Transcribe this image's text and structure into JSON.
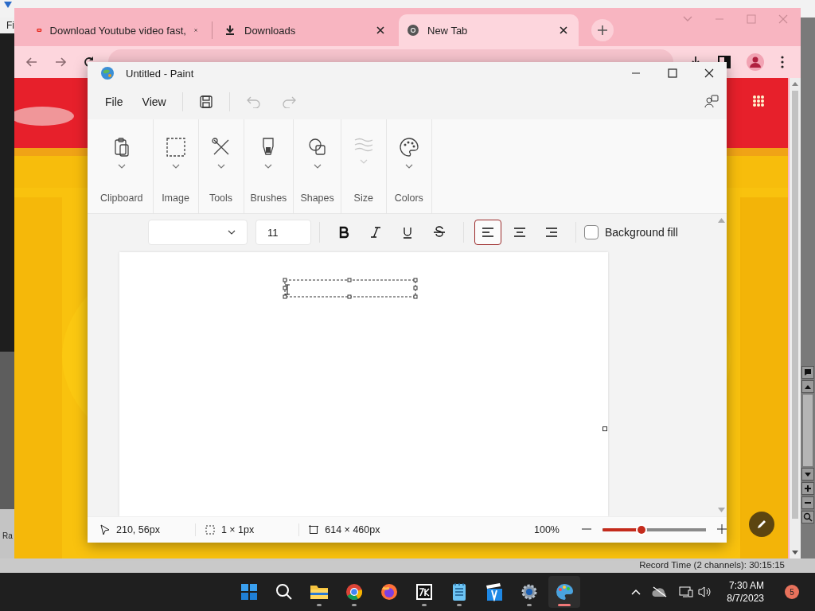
{
  "editor_app": {
    "menu_fragment": "Fi",
    "side_fragment": "Ra",
    "status": "Record Time (2 channels): 30:15:15"
  },
  "browser": {
    "tabs": [
      {
        "title": "Download Youtube video fast,",
        "kind": "video",
        "selected": false
      },
      {
        "title": "Downloads",
        "kind": "download",
        "selected": false
      },
      {
        "title": "New Tab",
        "kind": "chrome",
        "selected": true
      }
    ]
  },
  "paint": {
    "title": "Untitled - Paint",
    "menu": [
      "File",
      "View"
    ],
    "actions": [
      {
        "kind": "save",
        "disabled": false
      },
      {
        "kind": "undo",
        "disabled": true
      },
      {
        "kind": "redo",
        "disabled": true
      }
    ],
    "ribbon": [
      {
        "label": "Clipboard",
        "kind": "clipboard",
        "disabled": false
      },
      {
        "label": "Image",
        "disabled": false
      },
      {
        "label": "Tools",
        "kind": "tools",
        "disabled": false
      },
      {
        "label": "Brushes",
        "kind": "brushes",
        "disabled": false
      },
      {
        "label": "Shapes",
        "kind": "shapes",
        "disabled": false
      },
      {
        "label": "Size",
        "kind": "size",
        "disabled": true
      },
      {
        "label": "Colors",
        "kind": "colors",
        "disabled": false
      }
    ],
    "text_toolbar": {
      "font_size": "11",
      "styles": [
        {
          "kind": "bold",
          "selected": false
        },
        {
          "kind": "italic",
          "selected": false
        },
        {
          "kind": "underline",
          "selected": false
        },
        {
          "kind": "strikethrough",
          "selected": false
        }
      ],
      "align": [
        {
          "kind": "left",
          "selected": true
        },
        {
          "kind": "center",
          "selected": false
        },
        {
          "kind": "right",
          "selected": false
        }
      ],
      "background_fill": {
        "label": "Background fill",
        "checked": false
      }
    },
    "status": {
      "cursor": "210, 56px",
      "selection": "1 × 1px",
      "canvas_size": "614 × 460px",
      "zoom": "100%",
      "zoom_slider": {
        "level": 0.38
      }
    }
  },
  "taskbar": {
    "apps": [
      {
        "kind": "start",
        "running": false,
        "selected": false
      },
      {
        "kind": "search",
        "running": false,
        "selected": false
      },
      {
        "kind": "explorer",
        "running": true,
        "selected": false
      },
      {
        "kind": "chrome",
        "running": true,
        "selected": false
      },
      {
        "kind": "firefox",
        "running": false,
        "selected": false
      },
      {
        "kind": "archiver",
        "running": true,
        "selected": false
      },
      {
        "kind": "notepad",
        "running": true,
        "selected": false
      },
      {
        "kind": "video_editor",
        "running": false,
        "selected": false
      },
      {
        "kind": "settings",
        "running": true,
        "selected": false
      },
      {
        "kind": "paint",
        "running": true,
        "selected": true
      }
    ],
    "time": "7:30 AM",
    "date": "8/7/2023",
    "notifications": "5"
  }
}
